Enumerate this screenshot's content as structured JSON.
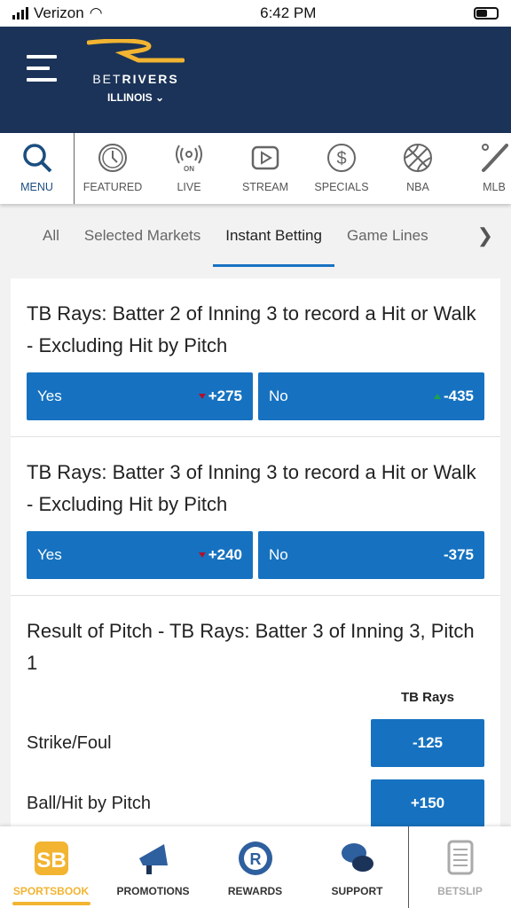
{
  "status": {
    "carrier": "Verizon",
    "time": "6:42 PM"
  },
  "header": {
    "brand_light": "BET",
    "brand_bold": "RIVERS",
    "state": "ILLINOIS ⌄"
  },
  "nav": [
    {
      "label": "MENU",
      "icon": "search-icon"
    },
    {
      "label": "FEATURED",
      "icon": "clock-icon"
    },
    {
      "label": "LIVE",
      "icon": "live-icon"
    },
    {
      "label": "STREAM",
      "icon": "play-icon"
    },
    {
      "label": "SPECIALS",
      "icon": "dollar-icon"
    },
    {
      "label": "NBA",
      "icon": "basketball-icon"
    },
    {
      "label": "MLB",
      "icon": "baseball-bat-icon"
    }
  ],
  "tabs": [
    "All",
    "Selected Markets",
    "Instant Betting",
    "Game Lines"
  ],
  "active_tab": "Instant Betting",
  "markets": [
    {
      "title": "TB Rays: Batter 2 of Inning 3 to record a Hit or Walk - Excluding Hit by Pitch",
      "options": [
        {
          "label": "Yes",
          "odds": "+275",
          "trend": "down"
        },
        {
          "label": "No",
          "odds": "-435",
          "trend": "up"
        }
      ]
    },
    {
      "title": "TB Rays: Batter 3 of Inning 3 to record a Hit or Walk - Excluding Hit by Pitch",
      "options": [
        {
          "label": "Yes",
          "odds": "+240",
          "trend": "down"
        },
        {
          "label": "No",
          "odds": "-375",
          "trend": "none"
        }
      ]
    }
  ],
  "pitch_market": {
    "title": "Result of Pitch - TB Rays: Batter 3 of Inning 3, Pitch 1",
    "column": "TB Rays",
    "rows": [
      {
        "label": "Strike/Foul",
        "odds": "-125"
      },
      {
        "label": "Ball/Hit by Pitch",
        "odds": "+150"
      }
    ]
  },
  "bottom_nav": [
    {
      "label": "SPORTSBOOK"
    },
    {
      "label": "PROMOTIONS"
    },
    {
      "label": "REWARDS"
    },
    {
      "label": "SUPPORT"
    },
    {
      "label": "BETSLIP"
    }
  ],
  "colors": {
    "navy": "#1b3358",
    "button_blue": "#1672c0",
    "gold": "#f2b431",
    "trend_down": "#b0102a",
    "trend_up": "#1ea34a"
  }
}
